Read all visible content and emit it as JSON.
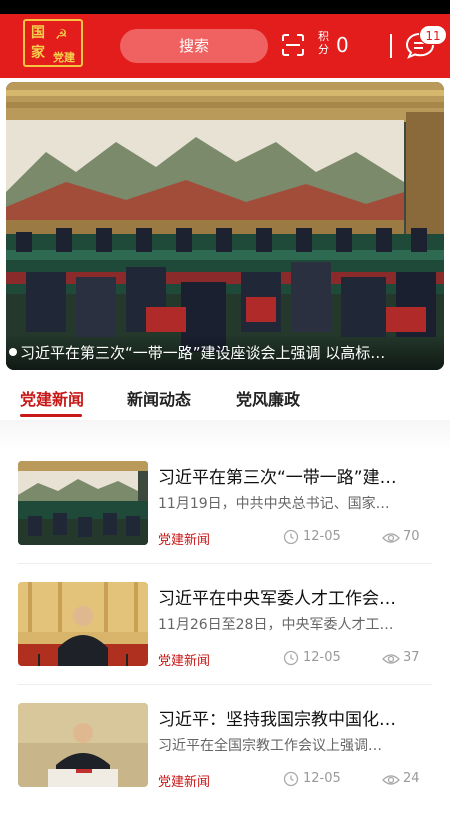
{
  "header": {
    "logo_chars": [
      "国",
      "家",
      "党建"
    ],
    "search_label": "搜索",
    "points_label": "积分",
    "points_value": "0",
    "message_count": "11",
    "colors": {
      "brand": "#e31c1c",
      "search_bg": "#f06262",
      "gold": "#f5c542"
    }
  },
  "banner": {
    "caption": "习近平在第三次“一带一路”建设座谈会上强调 以高标…"
  },
  "tabs": [
    {
      "label": "党建新闻",
      "active": true
    },
    {
      "label": "新闻动态",
      "active": false
    },
    {
      "label": "党风廉政",
      "active": false
    }
  ],
  "news": [
    {
      "title": "习近平在第三次“一带一路”建…",
      "summary": "11月19日，中共中央总书记、国家…",
      "category": "党建新闻",
      "date": "12-05",
      "views": "70",
      "thumb": "meeting"
    },
    {
      "title": "习近平在中央军委人才工作会…",
      "summary": "11月26日至28日，中央军委人才工…",
      "category": "党建新闻",
      "date": "12-05",
      "views": "37",
      "thumb": "speech"
    },
    {
      "title": "习近平：坚持我国宗教中国化…",
      "summary": "习近平在全国宗教工作会议上强调…",
      "category": "党建新闻",
      "date": "12-05",
      "views": "24",
      "thumb": "podium"
    }
  ]
}
